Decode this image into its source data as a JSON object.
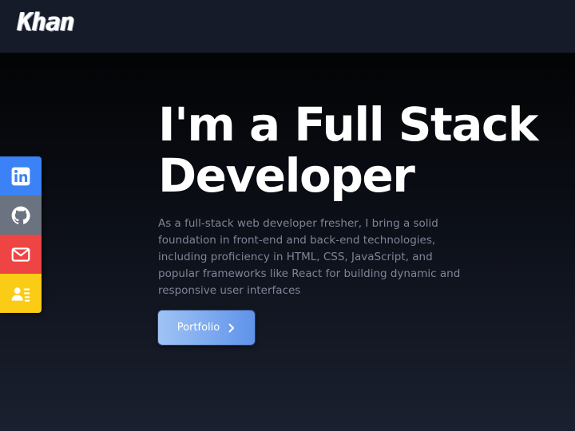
{
  "nav": {
    "logo_text": "Khan"
  },
  "hero": {
    "title_line1": "I'm a Full Stack",
    "title_line2": "Developer",
    "description": "As a full-stack web developer fresher, I bring a solid foundation in front-end and back-end technologies, including proficiency in HTML, CSS, JavaScript, and popular frameworks like React for building dynamic and responsive user interfaces",
    "cta_label": "Portfolio",
    "cta_icon": "chevron-right-icon"
  },
  "social": [
    {
      "icon": "linkedin-icon",
      "color": "#3b82f6"
    },
    {
      "icon": "github-icon",
      "color": "#6b7280"
    },
    {
      "icon": "mail-icon",
      "color": "#ef4444"
    },
    {
      "icon": "resume-icon",
      "color": "#facc15"
    }
  ],
  "colors": {
    "nav_bg": "#161b29",
    "accent": "#5f93ea",
    "text_muted": "#7e8596"
  }
}
